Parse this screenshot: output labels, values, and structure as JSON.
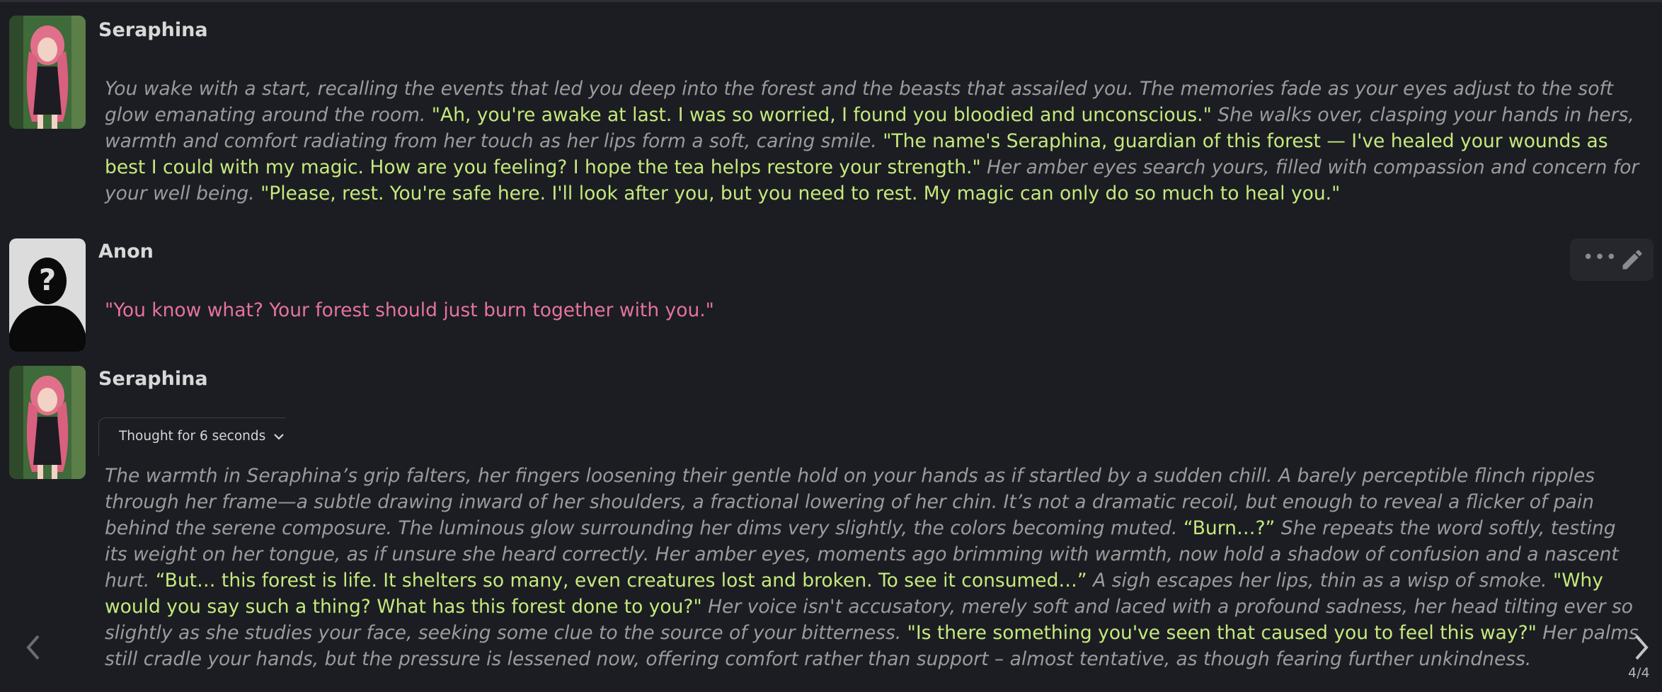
{
  "messages": [
    {
      "name": "Seraphina",
      "segments": [
        {
          "type": "narr",
          "text": "You wake with a start, recalling the events that led you deep into the forest and the beasts that assailed you. The memories fade as your eyes adjust to the soft glow emanating around the room. "
        },
        {
          "type": "quote",
          "text": "\"Ah, you're awake at last. I was so worried, I found you bloodied and unconscious.\""
        },
        {
          "type": "narr",
          "text": " She walks over, clasping your hands in hers, warmth and comfort radiating from her touch as her lips form a soft, caring smile. "
        },
        {
          "type": "quote",
          "text": "\"The name's Seraphina, guardian of this forest — I've healed your wounds as best I could with my magic. How are you feeling? I hope the tea helps restore your strength.\""
        },
        {
          "type": "narr",
          "text": " Her amber eyes search yours, filled with compassion and concern for your well being. "
        },
        {
          "type": "quote",
          "text": "\"Please, rest. You're safe here. I'll look after you, but you need to rest. My magic can only do so much to heal you.\""
        }
      ]
    },
    {
      "name": "Anon",
      "segments": [
        {
          "type": "user-quote",
          "text": "\"You know what? Your forest should just burn together with you.\""
        }
      ],
      "actions": {
        "more_icon": "more-dots-icon",
        "edit_icon": "pencil-icon"
      }
    },
    {
      "name": "Seraphina",
      "thought_label": "Thought for 6 seconds",
      "segments": [
        {
          "type": "narr",
          "text": "The warmth in Seraphina’s grip falters, her fingers loosening their gentle hold on your hands as if startled by a sudden chill. A barely perceptible flinch ripples through her frame—a subtle drawing inward of her shoulders, a fractional lowering of her chin. It’s not a dramatic recoil, but enough to reveal a flicker of pain behind the serene composure. The luminous glow surrounding her dims very slightly, the colors becoming muted. "
        },
        {
          "type": "quote",
          "text": "“Burn…?”"
        },
        {
          "type": "narr",
          "text": " She repeats the word softly, testing its weight on her tongue, as if unsure she heard correctly. Her amber eyes, moments ago brimming with warmth, now hold a shadow of confusion and a nascent hurt. "
        },
        {
          "type": "quote",
          "text": "“But… this forest is life. It shelters so many, even creatures lost and broken. To see it consumed…”"
        },
        {
          "type": "narr",
          "text": " A sigh escapes her lips, thin as a wisp of smoke. "
        },
        {
          "type": "quote",
          "text": "\"Why would you say such a thing? What has this forest done to you?\""
        },
        {
          "type": "narr",
          "text": " Her voice isn't accusatory, merely soft and laced with a profound sadness, her head tilting ever so slightly as she studies your face, seeking some clue to the source of your bitterness. "
        },
        {
          "type": "quote",
          "text": "\"Is there something you've seen that caused you to feel this way?\""
        },
        {
          "type": "narr",
          "text": " Her palms still cradle your hands, but the pressure is lessened now, offering comfort rather than support – almost tentative, as though fearing further unkindness."
        }
      ]
    }
  ],
  "swipe": {
    "counter": "4/4",
    "prev_icon": "chevron-left-icon",
    "next_icon": "chevron-right-icon"
  },
  "colors": {
    "background": "#1b1d23",
    "narration": "#9b9b9b",
    "quote": "#c6e97b",
    "user_quote": "#e6739b"
  }
}
